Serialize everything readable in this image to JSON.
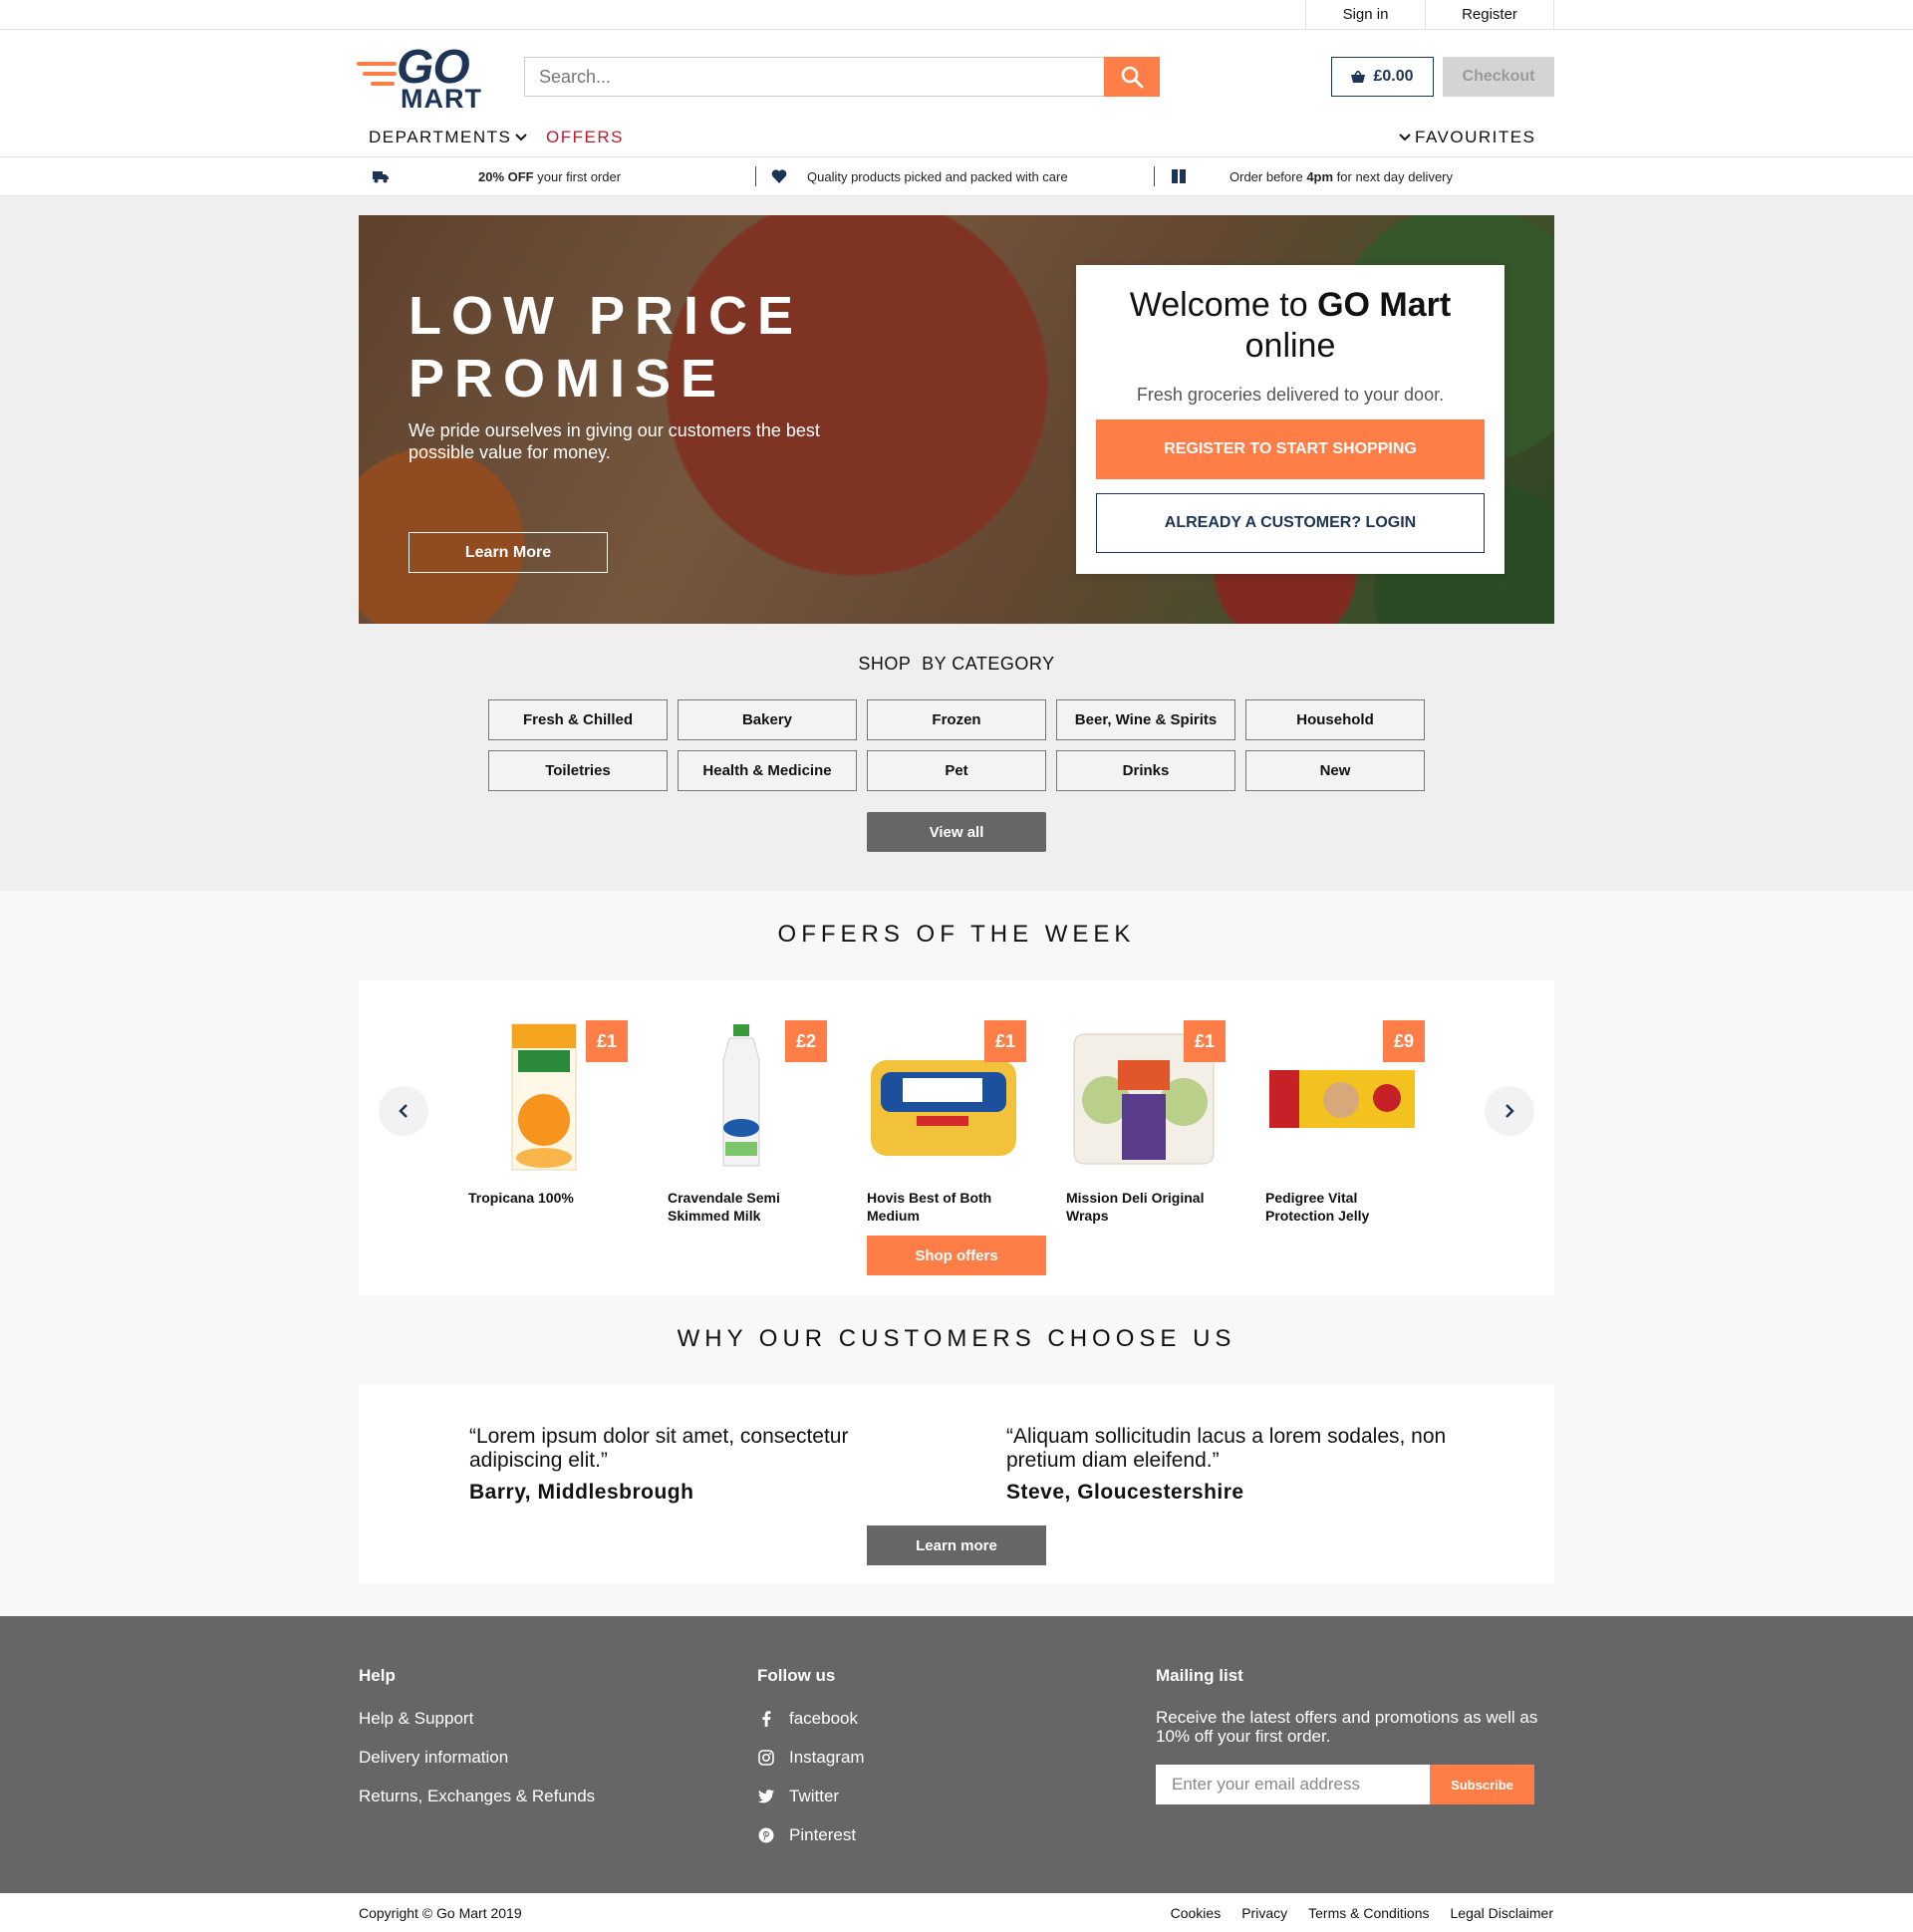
{
  "topbar": {
    "sign_in": "Sign in",
    "register": "Register"
  },
  "header": {
    "logo_go": "GO",
    "logo_mart": "MART",
    "search_placeholder": "Search...",
    "cart_total": "£0.00",
    "checkout": "Checkout",
    "nav": {
      "departments": "DEPARTMENTS",
      "offers": "OFFERS",
      "favourites": "FAVOURITES"
    }
  },
  "usp": [
    {
      "bold": "20% OFF",
      "text": " your first order",
      "icon": "truck-icon"
    },
    {
      "text": "Quality products picked and packed with care",
      "icon": "heart-icon"
    },
    {
      "pre": "Order before ",
      "bold": "4pm",
      "text": " for next day delivery",
      "icon": "box-icon"
    }
  ],
  "hero": {
    "title_line1": "LOW PRICE",
    "title_line2": "PROMISE",
    "subtitle": "We pride ourselves in giving our customers the best possible value for money.",
    "learn_more": "Learn More",
    "welcome_pre": "Welcome to ",
    "welcome_brand": "GO Mart",
    "welcome_post": "online",
    "welcome_sub": "Fresh groceries delivered to your door.",
    "register_cta": "REGISTER TO START SHOPPING",
    "login_cta": "ALREADY A CUSTOMER? LOGIN"
  },
  "categories": {
    "heading": "SHOP  BY CATEGORY",
    "items": [
      "Fresh & Chilled",
      "Bakery",
      "Frozen",
      "Beer, Wine & Spirits",
      "Household",
      "Toiletries",
      "Health & Medicine",
      "Pet",
      "Drinks",
      "New"
    ],
    "view_all": "View all"
  },
  "offers": {
    "title": "OFFERS OF THE WEEK",
    "products": [
      {
        "name": "Tropicana 100%",
        "price": "£1"
      },
      {
        "name": "Cravendale Semi Skimmed Milk",
        "price": "£2"
      },
      {
        "name": "Hovis Best of Both Medium",
        "price": "£1"
      },
      {
        "name": "Mission Deli Original Wraps",
        "price": "£1"
      },
      {
        "name": "Pedigree Vital Protection Jelly",
        "price": "£9"
      }
    ],
    "shop_offers": "Shop offers"
  },
  "testimonials": {
    "title": "WHY OUR CUSTOMERS CHOOSE US",
    "items": [
      {
        "quote": "“Lorem ipsum dolor sit amet, consectetur adipiscing elit.”",
        "author": "Barry, Middlesbrough"
      },
      {
        "quote": "“Aliquam sollicitudin lacus a lorem sodales, non pretium diam eleifend.”",
        "author": "Steve, Gloucestershire"
      }
    ],
    "learn_more": "Learn more"
  },
  "footer": {
    "help": {
      "heading": "Help",
      "links": [
        "Help & Support",
        "Delivery information",
        "Returns, Exchanges & Refunds"
      ]
    },
    "follow": {
      "heading": "Follow us",
      "links": [
        "facebook",
        "Instagram",
        "Twitter",
        "Pinterest"
      ]
    },
    "mailing": {
      "heading": "Mailing list",
      "text": "Receive the latest offers and promotions as well as 10% off your first order.",
      "placeholder": "Enter your email address",
      "subscribe": "Subscribe"
    }
  },
  "bottom": {
    "copyright": "Copyright © Go Mart 2019",
    "links": [
      "Cookies",
      "Privacy",
      "Terms & Conditions",
      "Legal Disclaimer"
    ]
  },
  "colors": {
    "accent": "#ff7d47",
    "navy": "#1c3557",
    "offers_red": "#c0182b",
    "footer": "#666666"
  }
}
